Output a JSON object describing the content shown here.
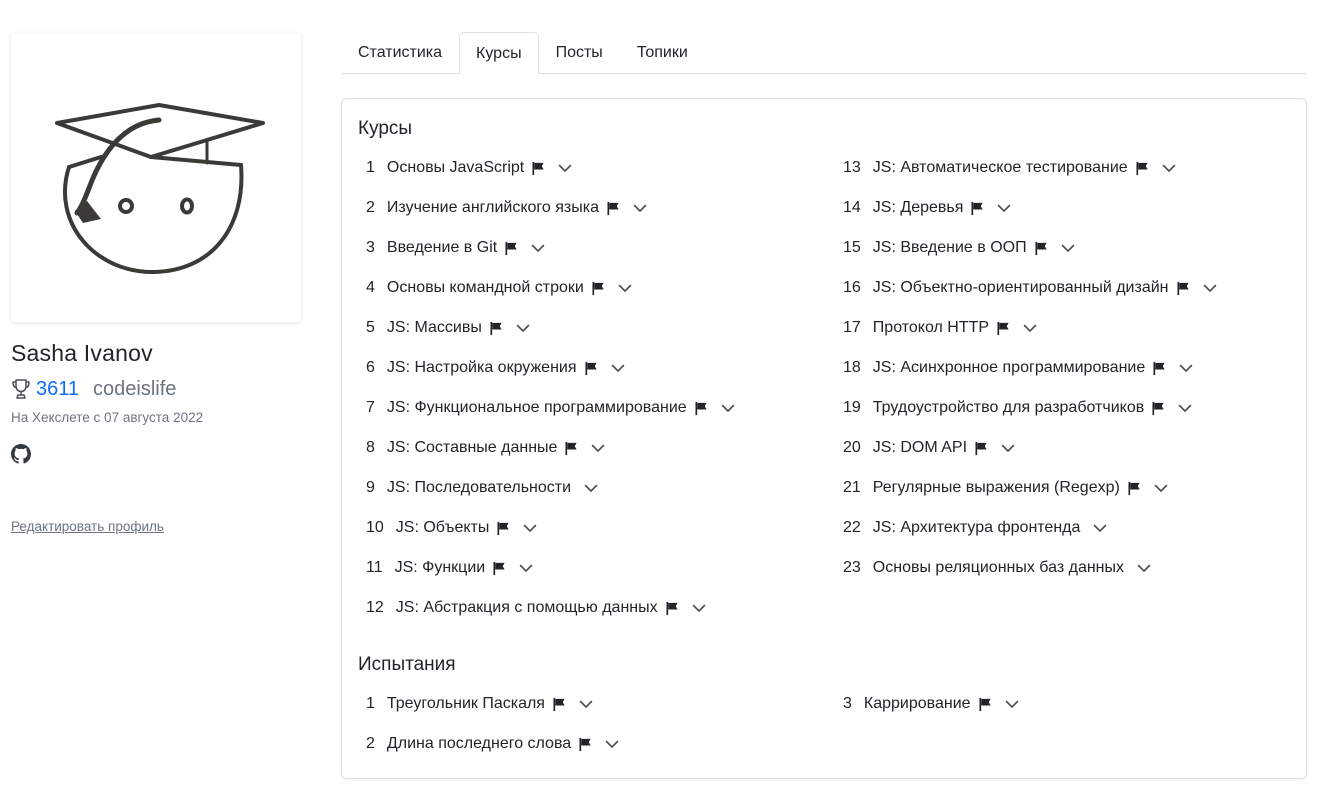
{
  "profile": {
    "name": "Sasha Ivanov",
    "points": "3611",
    "username": "codeislife",
    "joined": "На Хекслете с 07 августа 2022",
    "edit_link": "Редактировать профиль",
    "icons": {
      "trophy": "trophy-icon",
      "github": "github-icon"
    }
  },
  "tabs": [
    {
      "label": "Статистика",
      "active": false
    },
    {
      "label": "Курсы",
      "active": true
    },
    {
      "label": "Посты",
      "active": false
    },
    {
      "label": "Топики",
      "active": false
    }
  ],
  "courses": {
    "title": "Курсы",
    "items": [
      {
        "num": "1",
        "name": "Основы JavaScript",
        "flag": true
      },
      {
        "num": "2",
        "name": "Изучение английского языка",
        "flag": true
      },
      {
        "num": "3",
        "name": "Введение в Git",
        "flag": true
      },
      {
        "num": "4",
        "name": "Основы командной строки",
        "flag": true
      },
      {
        "num": "5",
        "name": "JS: Массивы",
        "flag": true
      },
      {
        "num": "6",
        "name": "JS: Настройка окружения",
        "flag": true
      },
      {
        "num": "7",
        "name": "JS: Функциональное программирование",
        "flag": true
      },
      {
        "num": "8",
        "name": "JS: Составные данные",
        "flag": true
      },
      {
        "num": "9",
        "name": "JS: Последовательности",
        "flag": false
      },
      {
        "num": "10",
        "name": "JS: Объекты",
        "flag": true
      },
      {
        "num": "11",
        "name": "JS: Функции",
        "flag": true
      },
      {
        "num": "12",
        "name": "JS: Абстракция с помощью данных",
        "flag": true
      },
      {
        "num": "13",
        "name": "JS: Автоматическое тестирование",
        "flag": true
      },
      {
        "num": "14",
        "name": "JS: Деревья",
        "flag": true
      },
      {
        "num": "15",
        "name": "JS: Введение в ООП",
        "flag": true
      },
      {
        "num": "16",
        "name": "JS: Объектно-ориентированный дизайн",
        "flag": true
      },
      {
        "num": "17",
        "name": "Протокол HTTP",
        "flag": true
      },
      {
        "num": "18",
        "name": "JS: Асинхронное программирование",
        "flag": true
      },
      {
        "num": "19",
        "name": "Трудоустройство для разработчиков",
        "flag": true
      },
      {
        "num": "20",
        "name": "JS: DOM API",
        "flag": true
      },
      {
        "num": "21",
        "name": "Регулярные выражения (Regexp)",
        "flag": true
      },
      {
        "num": "22",
        "name": "JS: Архитектура фронтенда",
        "flag": false
      },
      {
        "num": "23",
        "name": "Основы реляционных баз данных",
        "flag": false
      }
    ]
  },
  "challenges": {
    "title": "Испытания",
    "items": [
      {
        "num": "1",
        "name": "Треугольник Паскаля",
        "flag": true
      },
      {
        "num": "2",
        "name": "Длина последнего слова",
        "flag": true
      },
      {
        "num": "3",
        "name": "Каррирование",
        "flag": true
      }
    ]
  },
  "icons": {
    "flag": "flag-icon",
    "expand": "chevron-down-icon"
  }
}
